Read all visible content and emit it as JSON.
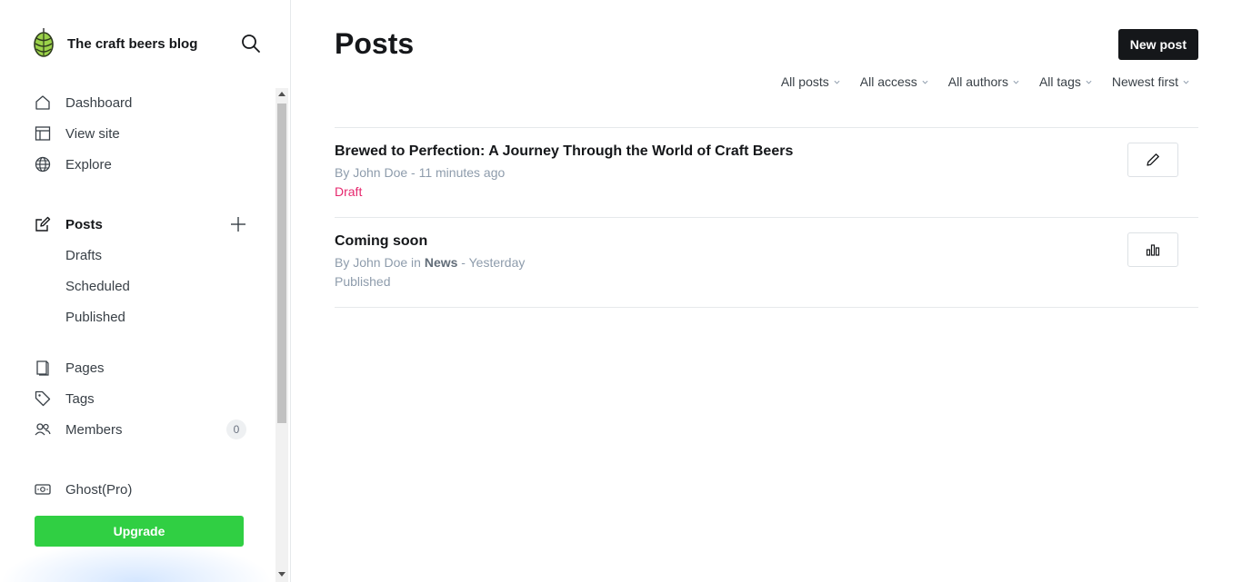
{
  "brand": {
    "name": "The craft beers blog"
  },
  "sidebar": {
    "primary": [
      {
        "label": "Dashboard",
        "icon": "home-icon"
      },
      {
        "label": "View site",
        "icon": "layout-icon"
      },
      {
        "label": "Explore",
        "icon": "globe-icon"
      }
    ],
    "posts": {
      "label": "Posts",
      "icon": "edit-icon"
    },
    "post_filters": [
      {
        "label": "Drafts"
      },
      {
        "label": "Scheduled"
      },
      {
        "label": "Published"
      }
    ],
    "secondary": [
      {
        "label": "Pages",
        "icon": "page-icon"
      },
      {
        "label": "Tags",
        "icon": "tag-icon"
      },
      {
        "label": "Members",
        "icon": "members-icon",
        "count": "0"
      }
    ],
    "ghost_pro": {
      "label": "Ghost(Pro)",
      "icon": "ghost-pro-icon"
    },
    "upgrade_label": "Upgrade"
  },
  "main": {
    "title": "Posts",
    "new_post_label": "New post",
    "filters": [
      {
        "label": "All posts"
      },
      {
        "label": "All access"
      },
      {
        "label": "All authors"
      },
      {
        "label": "All tags"
      },
      {
        "label": "Newest first"
      }
    ],
    "posts": [
      {
        "title": "Brewed to Perfection: A Journey Through the World of Craft Beers",
        "meta_prefix": "By John Doe - 11 minutes ago",
        "status": "Draft",
        "action_icon": "pencil-icon"
      },
      {
        "title": "Coming soon",
        "meta_by": "By John Doe in ",
        "meta_tag": "News",
        "meta_time": " - Yesterday",
        "status": "Published",
        "action_icon": "analytics-icon"
      }
    ]
  },
  "colors": {
    "accent_green": "#30cf43",
    "draft_pink": "#e6286e",
    "dark": "#15171a",
    "muted": "#8e9cac"
  }
}
